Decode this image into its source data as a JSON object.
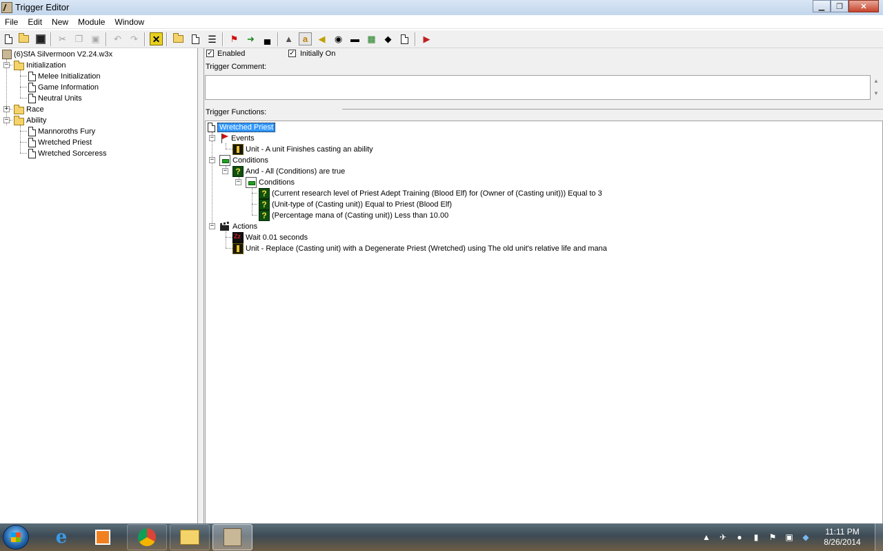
{
  "window": {
    "title": "Trigger Editor",
    "buttons": {
      "minimize": "▁",
      "maximize": "❐",
      "close": "✕"
    }
  },
  "menu": [
    "File",
    "Edit",
    "New",
    "Module",
    "Window"
  ],
  "toolbar": {
    "icons": [
      "new-document-icon",
      "open-folder-icon",
      "save-icon",
      "cut-icon",
      "copy-icon",
      "paste-icon",
      "undo-icon",
      "redo-icon",
      "delete-icon",
      "new-category-icon",
      "new-trigger-icon",
      "new-comment-icon",
      "new-event-icon",
      "new-condition-icon",
      "new-action-icon",
      "terrain-editor-icon",
      "trigger-editor-icon",
      "sound-editor-icon",
      "object-editor-icon",
      "campaign-editor-icon",
      "ai-editor-icon",
      "object-manager-icon",
      "import-manager-icon",
      "test-map-icon"
    ]
  },
  "left_tree": {
    "map_name": "(6)SfA Silvermoon V2.24.w3x",
    "categories": [
      {
        "name": "Initialization",
        "expanded": true,
        "triggers": [
          "Melee Initialization",
          "Game Information",
          "Neutral Units"
        ]
      },
      {
        "name": "Race",
        "expanded": false,
        "triggers": []
      },
      {
        "name": "Ability",
        "expanded": true,
        "triggers": [
          "Mannoroths Fury",
          "Wretched Priest",
          "Wretched Sorceress"
        ]
      }
    ]
  },
  "trigger_panel": {
    "enabled_label": "Enabled",
    "enabled_checked": true,
    "initially_on_label": "Initially On",
    "initially_on_checked": true,
    "comment_label": "Trigger Comment:",
    "comment_value": "",
    "functions_label": "Trigger Functions:"
  },
  "functions": {
    "trigger_name": "Wretched Priest",
    "events_label": "Events",
    "events": [
      "Unit - A unit Finishes casting an ability"
    ],
    "conditions_label": "Conditions",
    "and_condition": "And - All (Conditions) are true",
    "sub_conditions_label": "Conditions",
    "sub_conditions": [
      "(Current research level of Priest Adept Training (Blood Elf) for (Owner of (Casting unit))) Equal to 3",
      "(Unit-type of (Casting unit)) Equal to Priest (Blood Elf)",
      "(Percentage mana of (Casting unit)) Less than 10.00"
    ],
    "actions_label": "Actions",
    "actions": [
      "Wait 0.01 seconds",
      "Unit - Replace (Casting unit) with a Degenerate Priest (Wretched) using The old unit's relative life and mana"
    ]
  },
  "taskbar": {
    "apps": [
      "internet-explorer-icon",
      "media-player-icon",
      "chrome-icon",
      "file-explorer-icon",
      "world-editor-icon"
    ],
    "time": "11:11 PM",
    "date": "8/26/2014"
  }
}
